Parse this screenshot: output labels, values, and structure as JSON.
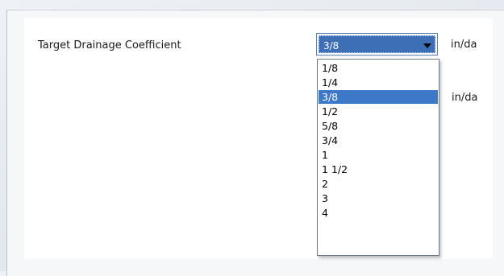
{
  "form": {
    "label": "Target Drainage Coefficient",
    "selected_value": "3/8",
    "unit": "in/da",
    "unit_secondary": "in/da"
  },
  "dropdown": {
    "options": [
      "1/8",
      "1/4",
      "3/8",
      "1/2",
      "5/8",
      "3/4",
      "1",
      "1 1/2",
      "2",
      "3",
      "4"
    ],
    "selected": "3/8"
  },
  "colors": {
    "selection": "#3d78c9",
    "combo_fill": "#3c6fb6",
    "border": "#5f82b4"
  }
}
